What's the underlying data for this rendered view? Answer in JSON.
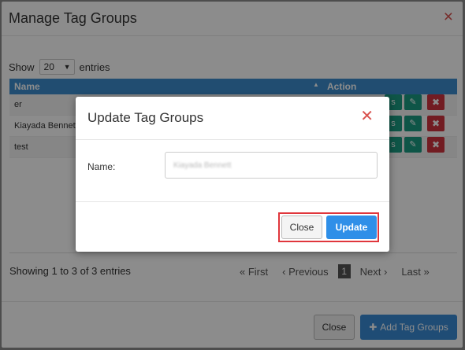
{
  "outer_modal": {
    "title": "Manage Tag Groups",
    "close_icon": "×"
  },
  "length_control": {
    "show_label": "Show",
    "selected": "20",
    "entries_label": "entries"
  },
  "table": {
    "headers": {
      "name": "Name",
      "action": "Action"
    },
    "rows": [
      {
        "name": "er"
      },
      {
        "name": "Kiayada Bennett"
      },
      {
        "name": "test"
      }
    ]
  },
  "pagination": {
    "info": "Showing 1 to 3 of 3 entries",
    "first": "« First",
    "prev": "‹ Previous",
    "current": "1",
    "next": "Next ›",
    "last": "Last »"
  },
  "outer_footer": {
    "close_label": "Close",
    "add_label": "Add Tag Groups"
  },
  "dialog": {
    "title": "Update Tag Groups",
    "name_label": "Name:",
    "name_value": "Kiayada Bennett",
    "close_label": "Close",
    "update_label": "Update"
  },
  "colors": {
    "header_blue": "#3c8dce",
    "edit_green": "#1a9c82",
    "delete_red": "#d0343f",
    "primary_blue": "#2f8fe8",
    "highlight_red": "#e0363c"
  }
}
